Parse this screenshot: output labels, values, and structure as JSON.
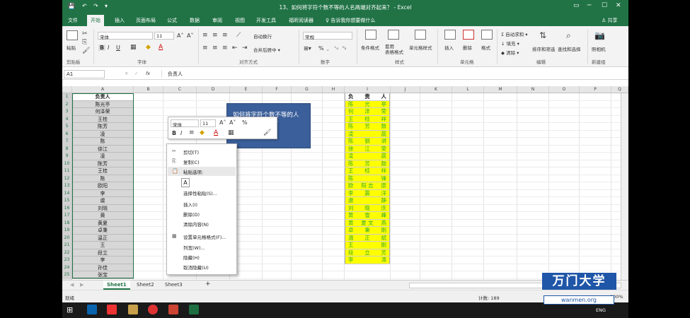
{
  "window": {
    "title": "13、如何将字符个数不等的人名两端对齐起来？ - Excel",
    "qat": [
      "💾",
      "↶",
      "↷",
      "▾"
    ],
    "controls": [
      "─",
      "☐",
      "✕"
    ],
    "ribbon_icon": "▭"
  },
  "menu": {
    "items": [
      "文件",
      "开始",
      "插入",
      "页面布局",
      "公式",
      "数据",
      "审阅",
      "视图",
      "开发工具",
      "福昕阅读器"
    ],
    "active_index": 1,
    "tell": "♀ 告诉我你想要做什么",
    "share": "♙ 共享"
  },
  "ribbon": {
    "paste_label": "粘贴",
    "font_name": "宋体",
    "font_size": "11",
    "number_format": "常规",
    "wrap_text": "自动换行",
    "merge_center": "合并后居中 ▾",
    "conditional_format": "条件格式",
    "table_format": "套用\n表格格式",
    "cell_styles": "单元格样式",
    "insert": "插入",
    "delete": "删除",
    "format": "格式",
    "autosum": "Σ 自动求和 ▾",
    "fill": "↓ 填充 ▾",
    "clear": "◆ 清除 ▾",
    "sort_filter": "排序和筛选",
    "find_select": "查找和选择",
    "camera": "照相机",
    "groups": [
      "剪贴板",
      "字体",
      "对齐方式",
      "数字",
      "样式",
      "单元格",
      "编辑",
      "新建组"
    ]
  },
  "formula_bar": {
    "name_box": "A1",
    "value": "负责人"
  },
  "columns": [
    "A",
    "B",
    "C",
    "D",
    "E",
    "F",
    "G",
    "H",
    "I",
    "J",
    "K",
    "L",
    "M",
    "N",
    "O",
    "P",
    "Q"
  ],
  "rows": [
    "1",
    "2",
    "3",
    "4",
    "5",
    "6",
    "7",
    "8",
    "9",
    "10",
    "11",
    "12",
    "13",
    "14",
    "15",
    "16",
    "17",
    "18",
    "19",
    "20",
    "21",
    "22",
    "23",
    "24",
    "25",
    "26"
  ],
  "column_a": [
    "负责人",
    "陈光亭",
    "何泽荣",
    "王桂",
    "陈芳",
    "凌",
    "陈",
    "徐江",
    "凌",
    "陈芳",
    "王桂",
    "陈",
    "欧阳",
    "李",
    "虞",
    "刘晓",
    "黄",
    "黄夏",
    "卓秉",
    "温正",
    "王",
    "段立",
    "李",
    "孙佳",
    "张宝"
  ],
  "column_i": [
    [
      "负",
      "责",
      "人"
    ],
    [
      "陈",
      "光",
      "亭"
    ],
    [
      "何",
      "泽",
      "荣"
    ],
    [
      "王",
      "桂",
      "祥"
    ],
    [
      "陈",
      "芳",
      "鼓"
    ],
    [
      "凌",
      "",
      "晨"
    ],
    [
      "陈",
      "钢",
      "讲"
    ],
    [
      "徐",
      "江",
      "荣"
    ],
    [
      "凌",
      "",
      "晨"
    ],
    [
      "陈",
      "芳",
      "鼓"
    ],
    [
      "王",
      "桂",
      "祥"
    ],
    [
      "陈",
      "",
      "锋"
    ],
    [
      "欧",
      "阳 志",
      "原"
    ],
    [
      "李",
      "震",
      "洋"
    ],
    [
      "虞",
      "",
      "静"
    ],
    [
      "刘",
      "晓",
      "庆"
    ],
    [
      "黄",
      "雪",
      "峰"
    ],
    [
      "黄",
      "夏 文",
      "燕"
    ],
    [
      "卓",
      "秉",
      "刚"
    ],
    [
      "温",
      "正",
      "斌"
    ],
    [
      "王",
      "",
      "刚"
    ],
    [
      "段",
      "立",
      "芳"
    ],
    [
      "李",
      "",
      "涛"
    ]
  ],
  "callout": {
    "text": "如何将字符个数不等的人名两端对齐起来？\n的效果"
  },
  "mini_toolbar": {
    "font": "宋体",
    "size": "11",
    "percent": "%",
    "bold": "B",
    "italic": "I"
  },
  "context_menu": {
    "items": [
      "剪切(T)",
      "复制(C)",
      "粘贴选项:",
      "",
      "选择性粘贴(S)...",
      "插入(I)",
      "删除(D)",
      "清除内容(N)",
      "设置单元格格式(F)...",
      "列宽(W)...",
      "隐藏(H)",
      "取消隐藏(U)"
    ],
    "icons": [
      "✂",
      "⎘",
      "📋",
      "",
      "",
      "",
      "",
      "",
      "▦",
      "",
      "",
      ""
    ],
    "paste_icon": "A"
  },
  "sheets": {
    "tabs": [
      "Sheet1",
      "Sheet2",
      "Sheet3"
    ],
    "active_index": 0,
    "add": "+"
  },
  "status": {
    "left": "就绪",
    "count": "计数: 189",
    "zoom": "100%"
  },
  "taskbar": {
    "lang": "ENG",
    "icon_colors": [
      "#0a64ad",
      "#e33",
      "#c8a04b",
      "#d33",
      "#c43",
      "#1d6f42"
    ]
  },
  "watermark": {
    "brand": "万门大学",
    "url": "wanmen.org"
  },
  "colors": {
    "excel_green": "#217346",
    "highlight_yellow": "#ffff00",
    "callout_blue": "#3a5f9a",
    "brand_blue": "#1f56a8"
  }
}
